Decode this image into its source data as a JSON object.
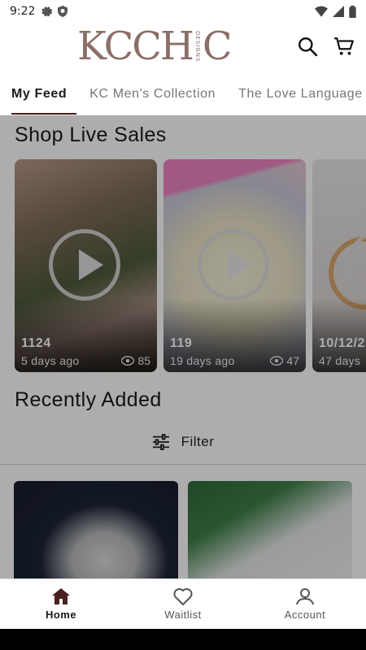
{
  "status_bar": {
    "time": "9:22"
  },
  "header": {
    "logo_main": "KCCH",
    "logo_designs": "DESIGNS",
    "logo_end": "C"
  },
  "tabs": [
    {
      "label": "My Feed",
      "active": true
    },
    {
      "label": "KC Men's Collection",
      "active": false
    },
    {
      "label": "The Love Language",
      "active": false
    }
  ],
  "live_sales": {
    "title": "Shop Live Sales",
    "cards": [
      {
        "title": "1124",
        "age": "5 days ago",
        "views": "85"
      },
      {
        "title": "119",
        "age": "19 days ago",
        "views": "47"
      },
      {
        "title": "10/12/2",
        "age": "47 days",
        "views": ""
      }
    ]
  },
  "recently_added": {
    "title": "Recently Added",
    "filter_label": "Filter"
  },
  "bottom_nav": {
    "items": [
      {
        "label": "Home",
        "icon": "home-icon",
        "active": true
      },
      {
        "label": "Waitlist",
        "icon": "heart-icon",
        "active": false
      },
      {
        "label": "Account",
        "icon": "account-icon",
        "active": false
      }
    ]
  },
  "colors": {
    "brand": "#8a6e67",
    "accent": "#4a1f1f"
  }
}
